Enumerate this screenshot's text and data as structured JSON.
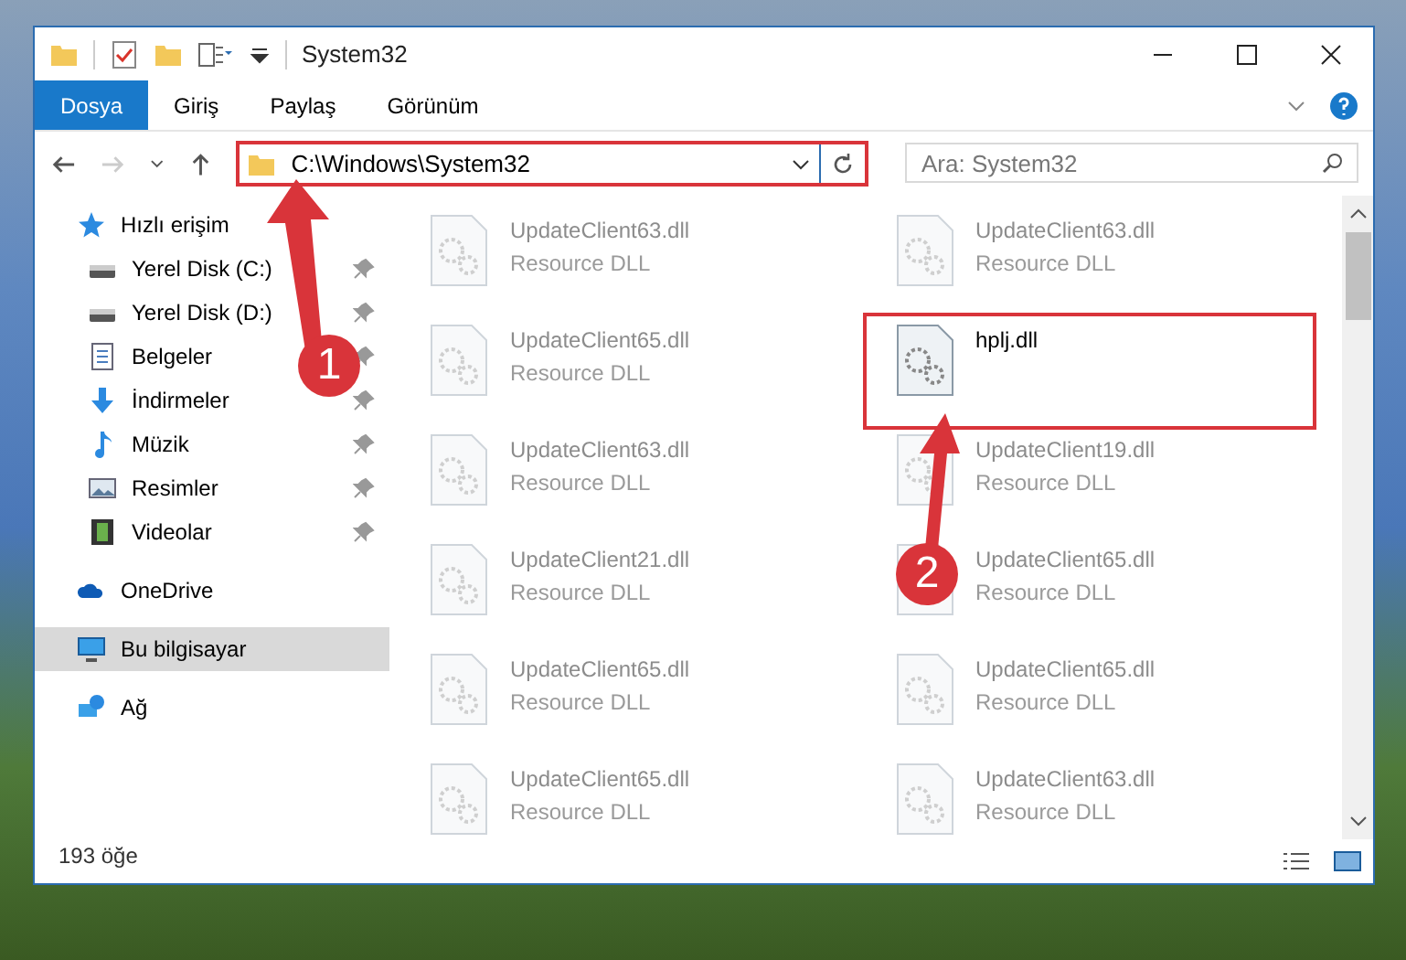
{
  "window": {
    "title": "System32"
  },
  "ribbon_tabs": [
    {
      "label": "Dosya",
      "selected": true
    },
    {
      "label": "Giriş",
      "selected": false
    },
    {
      "label": "Paylaş",
      "selected": false
    },
    {
      "label": "Görünüm",
      "selected": false
    }
  ],
  "address_bar": {
    "path": "C:\\Windows\\System32",
    "highlighted": true
  },
  "search": {
    "placeholder": "Ara: System32"
  },
  "sidebar": {
    "items": [
      {
        "label": "Hızlı erişim",
        "kind": "star",
        "pinned": false,
        "selected": false,
        "children": [
          {
            "label": "Yerel Disk (C:)",
            "kind": "drive",
            "pinned": true,
            "selected": false
          },
          {
            "label": "Yerel Disk (D:)",
            "kind": "drive",
            "pinned": true,
            "selected": false
          },
          {
            "label": "Belgeler",
            "kind": "document",
            "pinned": true,
            "selected": false
          },
          {
            "label": "İndirmeler",
            "kind": "download",
            "pinned": true,
            "selected": false
          },
          {
            "label": "Müzik",
            "kind": "music",
            "pinned": true,
            "selected": false
          },
          {
            "label": "Resimler",
            "kind": "picture",
            "pinned": true,
            "selected": false
          },
          {
            "label": "Videolar",
            "kind": "video",
            "pinned": true,
            "selected": false
          }
        ]
      },
      {
        "label": "OneDrive",
        "kind": "cloud",
        "pinned": false,
        "selected": false
      },
      {
        "label": "Bu bilgisayar",
        "kind": "computer",
        "pinned": false,
        "selected": true
      },
      {
        "label": "Ağ",
        "kind": "network",
        "pinned": false,
        "selected": false
      }
    ]
  },
  "files": [
    {
      "name": "UpdateClient63.dll",
      "type": "Resource DLL",
      "blurred": true,
      "highlighted": false
    },
    {
      "name": "UpdateClient63.dll",
      "type": "Resource DLL",
      "blurred": true,
      "highlighted": false
    },
    {
      "name": "UpdateClient65.dll",
      "type": "Resource DLL",
      "blurred": true,
      "highlighted": false
    },
    {
      "name": "hplj.dll",
      "blurred": false,
      "highlighted": true
    },
    {
      "name": "UpdateClient63.dll",
      "type": "Resource DLL",
      "blurred": true,
      "highlighted": false
    },
    {
      "name": "UpdateClient19.dll",
      "type": "Resource DLL",
      "blurred": true,
      "highlighted": false
    },
    {
      "name": "UpdateClient21.dll",
      "type": "Resource DLL",
      "blurred": true,
      "highlighted": false
    },
    {
      "name": "UpdateClient65.dll",
      "type": "Resource DLL",
      "blurred": true,
      "highlighted": false
    },
    {
      "name": "UpdateClient65.dll",
      "type": "Resource DLL",
      "blurred": true,
      "highlighted": false
    },
    {
      "name": "UpdateClient65.dll",
      "type": "Resource DLL",
      "blurred": true,
      "highlighted": false
    },
    {
      "name": "UpdateClient65.dll",
      "type": "Resource DLL",
      "blurred": true,
      "highlighted": false
    },
    {
      "name": "UpdateClient63.dll",
      "type": "Resource DLL",
      "blurred": true,
      "highlighted": false
    }
  ],
  "status_bar": {
    "count": "193 öğe"
  },
  "callouts": [
    {
      "number": "1"
    },
    {
      "number": "2"
    }
  ]
}
